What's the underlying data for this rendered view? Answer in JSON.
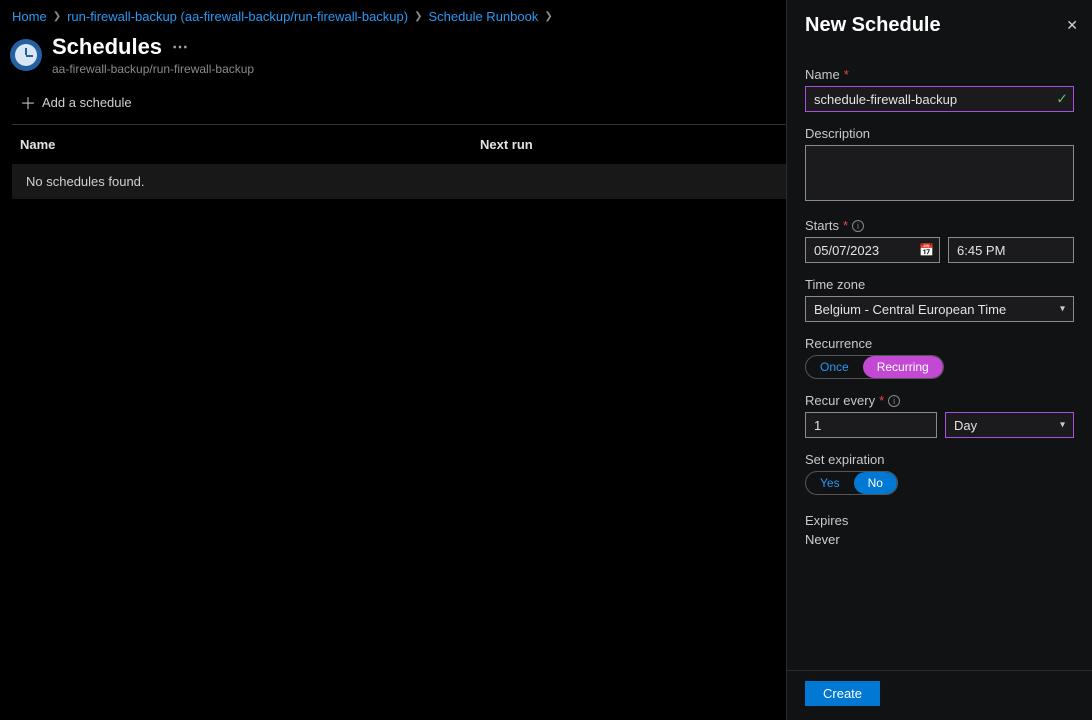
{
  "breadcrumbs": {
    "home": "Home",
    "runbook": "run-firewall-backup (aa-firewall-backup/run-firewall-backup)",
    "schedule": "Schedule Runbook"
  },
  "header": {
    "title": "Schedules",
    "subtitle": "aa-firewall-backup/run-firewall-backup"
  },
  "toolbar": {
    "add_label": "Add a schedule"
  },
  "table": {
    "col_name": "Name",
    "col_next": "Next run",
    "empty": "No schedules found."
  },
  "panel": {
    "title": "New Schedule",
    "name_label": "Name",
    "name_value": "schedule-firewall-backup",
    "desc_label": "Description",
    "desc_value": "",
    "starts_label": "Starts",
    "date_value": "05/07/2023",
    "time_value": "6:45 PM",
    "tz_label": "Time zone",
    "tz_value": "Belgium - Central European Time",
    "recurrence_label": "Recurrence",
    "once_label": "Once",
    "recurring_label": "Recurring",
    "recur_every_label": "Recur every",
    "recur_num": "1",
    "recur_unit": "Day",
    "exp_label": "Set expiration",
    "yes_label": "Yes",
    "no_label": "No",
    "expires_label": "Expires",
    "expires_value": "Never",
    "create_label": "Create"
  }
}
